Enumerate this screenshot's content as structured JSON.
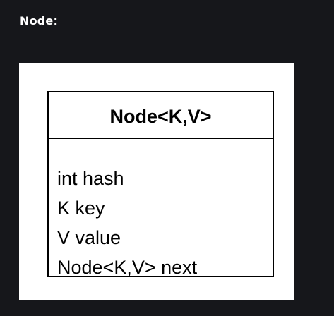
{
  "heading": "Node:",
  "diagram": {
    "class_name": "Node<K,V>",
    "fields": [
      "int hash",
      "K key",
      "V value",
      "Node<K,V> next"
    ]
  }
}
